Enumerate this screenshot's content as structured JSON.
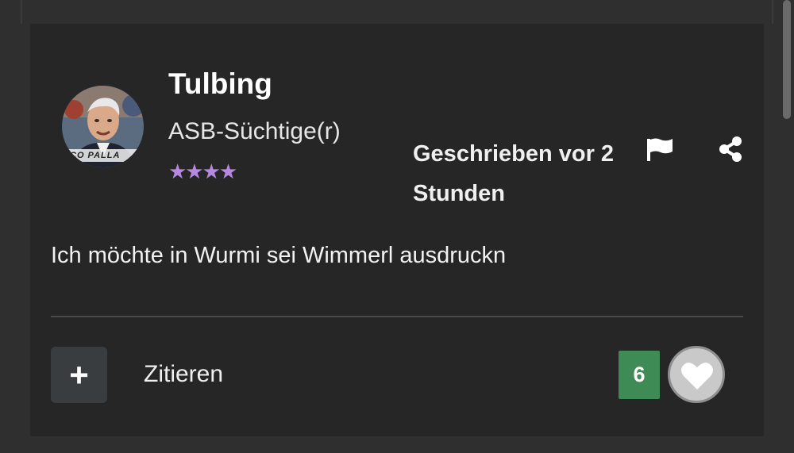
{
  "post": {
    "author": {
      "name": "Tulbing",
      "rank": "ASB-Süchtige(r)",
      "stars": "★★★★",
      "star_count": 4,
      "avatar_caption": "CO PALLA"
    },
    "timestamp": "Geschrieben vor 2 Stunden",
    "body": "Ich möchte in Wurmi sei Wimmerl ausdruckn",
    "actions": {
      "flag_icon": "flag-icon",
      "share_icon": "share-icon",
      "multiquote_label": "+",
      "quote_label": "Zitieren",
      "reaction_count": "6",
      "like_icon": "heart-icon"
    }
  },
  "colors": {
    "card_background": "#262626",
    "page_background": "#2f2f2f",
    "reaction_badge": "#3f8b55",
    "stars": "#b788e0"
  }
}
